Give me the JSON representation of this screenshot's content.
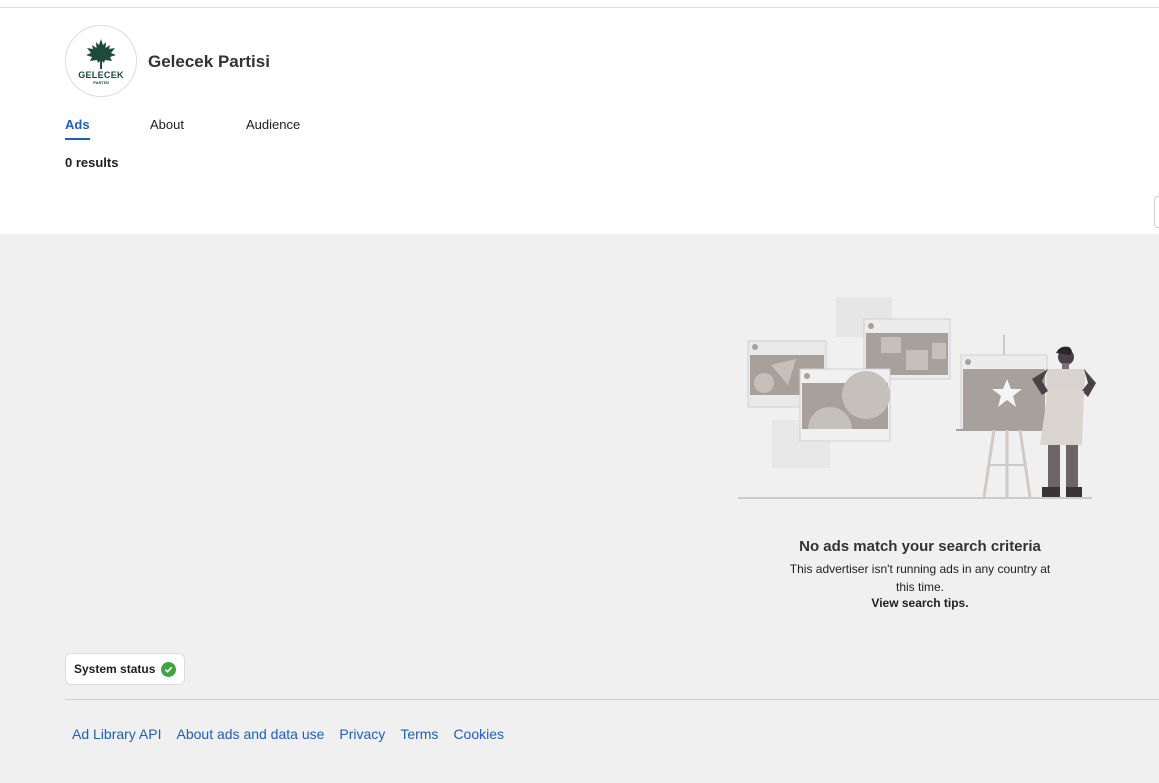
{
  "header": {
    "page_name": "Gelecek Partisi",
    "logo": {
      "icon": "maple-leaf-icon",
      "text": "GELECEK",
      "subtext": "PARTİSİ",
      "color": "#1d4a3a"
    }
  },
  "tabs": [
    {
      "label": "Ads",
      "active": true
    },
    {
      "label": "About",
      "active": false
    },
    {
      "label": "Audience",
      "active": false
    }
  ],
  "results_label": "0 results",
  "empty_state": {
    "illustration": "woman-with-ad-boards-illustration",
    "title": "No ads match your search criteria",
    "description": "This advertiser isn't running ads in any country at this time.",
    "tips_link": "View search tips."
  },
  "system_status": {
    "label": "System status",
    "status_icon": "check-circle-icon",
    "status_color": "#42a342"
  },
  "footer": {
    "links": [
      "Ad Library API",
      "About ads and data use",
      "Privacy",
      "Terms",
      "Cookies"
    ]
  },
  "colors": {
    "accent": "#1b5fc1",
    "background": "#f0f0f0"
  }
}
